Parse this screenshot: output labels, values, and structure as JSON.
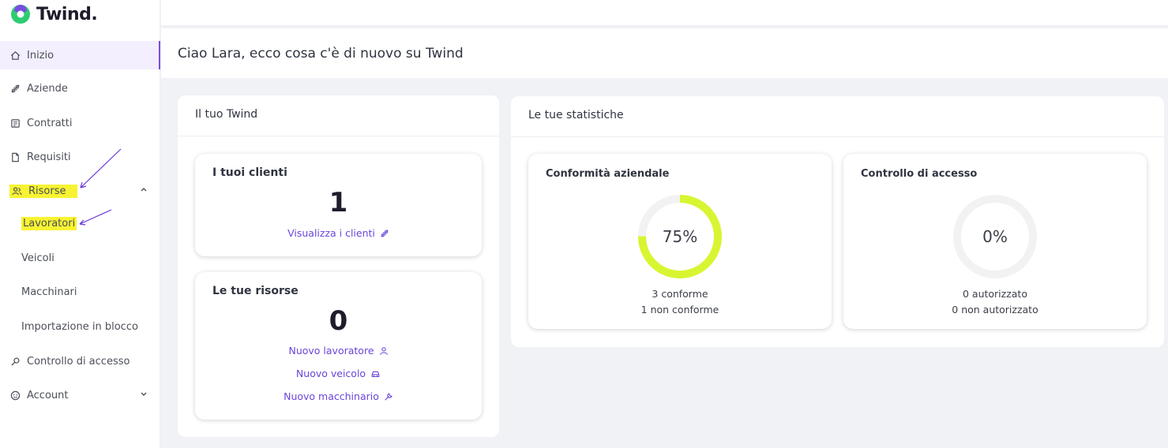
{
  "app": {
    "name": "Twind."
  },
  "sidebar": {
    "items": [
      {
        "label": "Inizio",
        "icon": "home-icon"
      },
      {
        "label": "Aziende",
        "icon": "link-icon"
      },
      {
        "label": "Contratti",
        "icon": "contract-icon"
      },
      {
        "label": "Requisiti",
        "icon": "document-icon"
      },
      {
        "label": "Risorse",
        "icon": "people-icon"
      },
      {
        "label": "Controllo di accesso",
        "icon": "key-icon"
      },
      {
        "label": "Account",
        "icon": "account-icon"
      }
    ],
    "sub_items": [
      {
        "label": "Lavoratori"
      },
      {
        "label": "Veicoli"
      },
      {
        "label": "Macchinari"
      },
      {
        "label": "Importazione in blocco"
      }
    ]
  },
  "header": {
    "title": "Ciao Lara, ecco cosa c'è di nuovo su Twind"
  },
  "twind_panel": {
    "title": "Il tuo Twind",
    "clients": {
      "title": "I tuoi clienti",
      "count": "1",
      "link": "Visualizza i clienti"
    },
    "resources": {
      "title": "Le tue risorse",
      "count": "0",
      "links": [
        "Nuovo lavoratore",
        "Nuovo veicolo",
        "Nuovo macchinario"
      ]
    }
  },
  "stats_panel": {
    "title": "Le tue statistiche",
    "compliance": {
      "title": "Conformità aziendale",
      "percent_label": "75%",
      "percent": 75,
      "line1": "3 conforme",
      "line2": "1 non conforme",
      "color": "#d9f531"
    },
    "access": {
      "title": "Controllo di accesso",
      "percent_label": "0%",
      "percent": 0,
      "line1": "0 autorizzato",
      "line2": "0 non autorizzato",
      "color": "#d9f531"
    }
  },
  "colors": {
    "accent": "#6a45d8",
    "highlight": "#f7f332",
    "logo_green": "#2ecc71",
    "logo_purple": "#7a4ee0"
  }
}
